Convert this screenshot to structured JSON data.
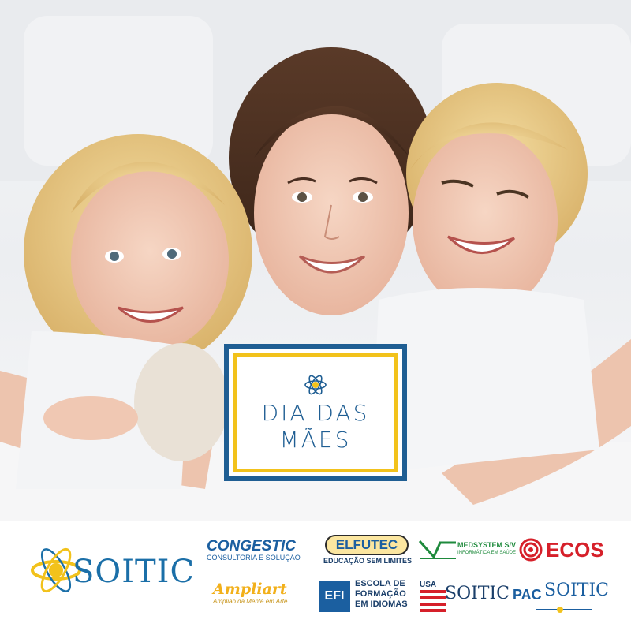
{
  "card": {
    "line1": "DIA DAS",
    "line2": "MÃES"
  },
  "brand": {
    "name": "SOITIC",
    "color_blue": "#1b6fa8",
    "color_yellow": "#f2c21b"
  },
  "partners": {
    "congestic": {
      "name": "CONGESTIC",
      "tagline": "CONSULTORIA E SOLUÇÃO"
    },
    "elfutec": {
      "name": "ELFUTEC",
      "tagline": "EDUCAÇÃO SEM LIMITES"
    },
    "medsystem": {
      "name": "MEDSYSTEM S/V",
      "tagline": "INFORMÁTICA EM SAÚDE"
    },
    "ecos": {
      "name": "ECOS"
    },
    "ampliart": {
      "name": "Ampliart",
      "tagline": "Amplião da Mente em Arte"
    },
    "efi": {
      "mark": "EFI",
      "line1": "ESCOLA DE",
      "line2": "FORMAÇÃO",
      "line3": "EM IDIOMAS"
    },
    "usa_soitic": {
      "prefix": "USA",
      "name": "SOITIC"
    },
    "pac_soitic": {
      "prefix": "PAC",
      "name": "SOITIC"
    }
  }
}
